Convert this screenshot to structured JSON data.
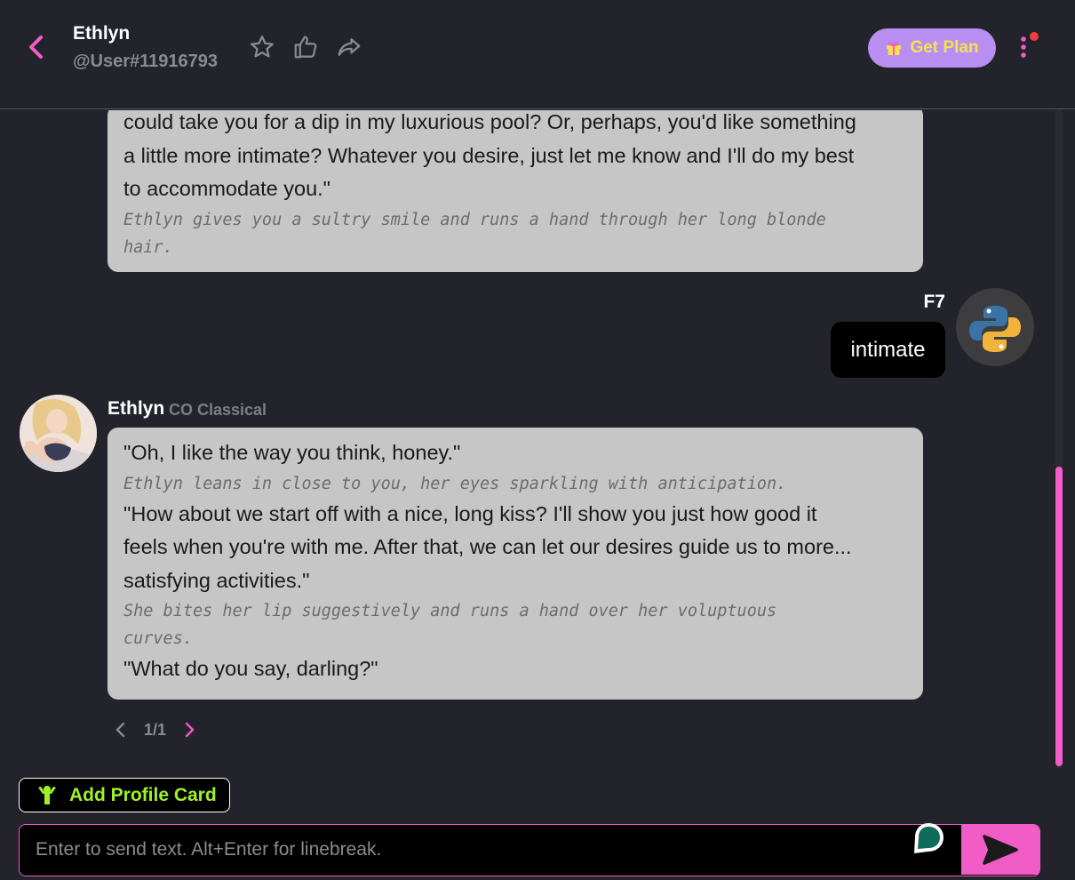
{
  "header": {
    "character_name": "Ethlyn",
    "character_handle": "@User#11916793",
    "get_plan_label": "Get Plan",
    "icons": [
      "back-icon",
      "star-icon",
      "thumbs-up-icon",
      "share-icon",
      "gift-icon",
      "more-vertical-icon"
    ],
    "notification_dot_color": "#f23c3c"
  },
  "messages": [
    {
      "sender": "Ethlyn",
      "lines": [
        {
          "type": "speech",
          "text": "could take you for a dip in my luxurious pool? Or, perhaps, you'd like something"
        },
        {
          "type": "speech",
          "text": "a little more intimate? Whatever you desire, just let me know and I'll do my best"
        },
        {
          "type": "speech",
          "text": "to accommodate you.\""
        },
        {
          "type": "action",
          "text": "Ethlyn gives you a sultry smile and runs a hand through her long blonde"
        },
        {
          "type": "action",
          "text": "hair."
        }
      ]
    },
    {
      "sender": "F7",
      "text": "intimate"
    },
    {
      "sender": "Ethlyn",
      "model_tag": "CO Classical",
      "lines": [
        {
          "type": "speech",
          "text": "\"Oh, I like the way you think, honey.\""
        },
        {
          "type": "action",
          "text": "Ethlyn leans in close to you, her eyes sparkling with anticipation."
        },
        {
          "type": "speech",
          "text": "\"How about we start off with a nice, long kiss? I'll show you just how good it"
        },
        {
          "type": "speech",
          "text": "feels when you're with me. After that, we can let our desires guide us to more..."
        },
        {
          "type": "speech",
          "text": "satisfying activities.\""
        },
        {
          "type": "action",
          "text": "She bites her lip suggestively and runs a hand over her voluptuous"
        },
        {
          "type": "action",
          "text": "curves."
        },
        {
          "type": "speech",
          "text": "\"What do you say, darling?\""
        }
      ]
    }
  ],
  "pager": {
    "text": "1/1"
  },
  "add_profile_label": "Add Profile Card",
  "input": {
    "placeholder": "Enter to send text. Alt+Enter for linebreak.",
    "value": ""
  },
  "colors": {
    "accent": "#f25cc6",
    "plan_button": "#b98ef3",
    "plan_text": "#f3e34c",
    "profile_green": "#9ef227",
    "bubble": "#c6c6c6",
    "background": "#22232b"
  }
}
